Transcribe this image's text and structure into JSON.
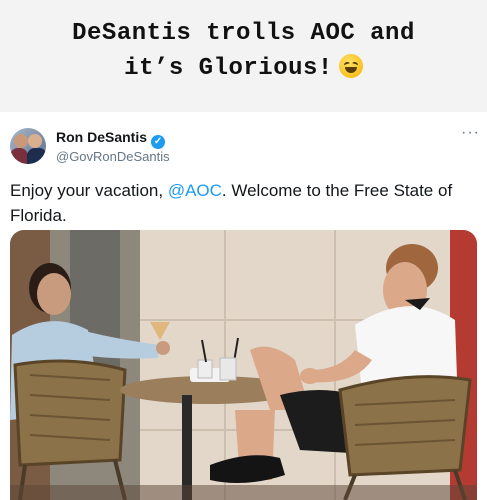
{
  "caption": {
    "line1": "DeSantis trolls AOC and",
    "line2": "it’s Glorious!",
    "emoji_icon": "rolling-on-floor-laughing-emoji"
  },
  "tweet": {
    "author_name": "Ron DeSantis",
    "verified_icon": "check-icon",
    "handle": "@GovRonDeSantis",
    "more_label": "···",
    "text_before": "Enjoy your vacation, ",
    "mention": "@AOC",
    "text_after": ". Welcome to the Free State of Florida."
  },
  "colors": {
    "accent": "#1d9bf0",
    "secondary_text": "#657786"
  }
}
